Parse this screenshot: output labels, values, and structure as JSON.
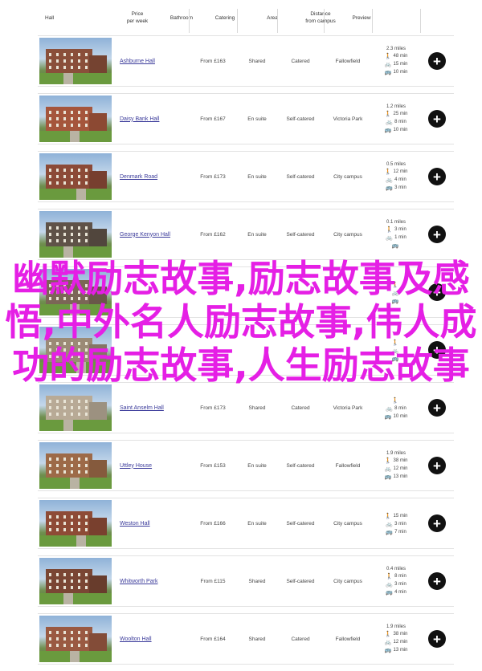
{
  "header": {
    "hall": "Hall",
    "price": [
      "Price",
      "per week"
    ],
    "bathroom": "Bathroom",
    "catering": "Catering",
    "area": "Area",
    "distance": [
      "Distance",
      "from campus"
    ],
    "preview": "Preview"
  },
  "icons": {
    "walk": "walking-person-icon",
    "bike": "bicycle-icon",
    "bus": "bus-icon",
    "add": "plus-icon"
  },
  "rows": [
    {
      "name": "Ashburne Hall",
      "price": "From £163",
      "bathroom": "Shared",
      "catering": "Catered",
      "area": "Fallowfield",
      "miles": "2.3 miles",
      "walk": "48 min",
      "bike": "15 min",
      "bus": "10 min"
    },
    {
      "name": "Daisy Bank Hall",
      "price": "From £167",
      "bathroom": "En suite",
      "catering": "Self-catered",
      "area": "Victoria Park",
      "miles": "1.2 miles",
      "walk": "25 min",
      "bike": "8 min",
      "bus": "10 min"
    },
    {
      "name": "Denmark Road",
      "price": "From £173",
      "bathroom": "En suite",
      "catering": "Self-catered",
      "area": "City campus",
      "miles": "0.5 miles",
      "walk": "12 min",
      "bike": "4 min",
      "bus": "3 min"
    },
    {
      "name": "George Kenyon Hall",
      "price": "From £162",
      "bathroom": "En suite",
      "catering": "Self-catered",
      "area": "City campus",
      "miles": "0.1 miles",
      "walk": "3 min",
      "bike": "1 min",
      "bus": ""
    },
    {
      "name": "",
      "price": "",
      "bathroom": "",
      "catering": "",
      "area": "",
      "miles": "",
      "walk": "",
      "bike": "",
      "bus": ""
    },
    {
      "name": "",
      "price": "",
      "bathroom": "",
      "catering": "",
      "area": "",
      "miles": "",
      "walk": "",
      "bike": "",
      "bus": ""
    },
    {
      "name": "Saint Anselm Hall",
      "price": "From £173",
      "bathroom": "Shared",
      "catering": "Catered",
      "area": "Victoria Park",
      "miles": "",
      "walk": "",
      "bike": "8 min",
      "bus": "10 min"
    },
    {
      "name": "Uttley House",
      "price": "From £153",
      "bathroom": "En suite",
      "catering": "Self-catered",
      "area": "Fallowfield",
      "miles": "1.9 miles",
      "walk": "38 min",
      "bike": "12 min",
      "bus": "13 min"
    },
    {
      "name": "Weston Hall",
      "price": "From £166",
      "bathroom": "En suite",
      "catering": "Self-catered",
      "area": "City campus",
      "miles": "",
      "walk": "15 min",
      "bike": "3 min",
      "bus": "7 min"
    },
    {
      "name": "Whitworth Park",
      "price": "From £115",
      "bathroom": "Shared",
      "catering": "Self-catered",
      "area": "City campus",
      "miles": "0.4 miles",
      "walk": "8 min",
      "bike": "3 min",
      "bus": "4 min"
    },
    {
      "name": "Woolton Hall",
      "price": "From £164",
      "bathroom": "Shared",
      "catering": "Catered",
      "area": "Fallowfield",
      "miles": "1.9 miles",
      "walk": "38 min",
      "bike": "12 min",
      "bus": "13 min"
    }
  ],
  "overlay_text": "幽默励志故事,励志故事及感悟,中外名人励志故事,伟人成功的励志故事,人生励志故事",
  "colors": {
    "overlay": "#e51fe5",
    "link": "#3a3a9a",
    "button": "#111111"
  }
}
